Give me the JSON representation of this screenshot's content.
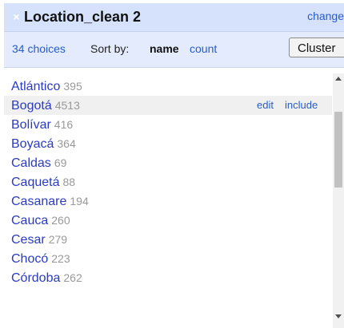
{
  "facet": {
    "title": "Location_clean 2",
    "change_label": "change",
    "choices_count": "34 choices",
    "sort_by_label": "Sort by:",
    "sort_name_label": "name",
    "sort_count_label": "count",
    "cluster_label": "Cluster"
  },
  "rows": [
    {
      "name": "Atlántico",
      "count": "395"
    },
    {
      "name": "Bogotá",
      "count": "4513",
      "edit": "edit",
      "include": "include"
    },
    {
      "name": "Bolívar",
      "count": "416"
    },
    {
      "name": "Boyacá",
      "count": "364"
    },
    {
      "name": "Caldas",
      "count": "69"
    },
    {
      "name": "Caquetá",
      "count": "88"
    },
    {
      "name": "Casanare",
      "count": "194"
    },
    {
      "name": "Cauca",
      "count": "260"
    },
    {
      "name": "Cesar",
      "count": "279"
    },
    {
      "name": "Chocó",
      "count": "223"
    },
    {
      "name": "Córdoba",
      "count": "262"
    }
  ]
}
